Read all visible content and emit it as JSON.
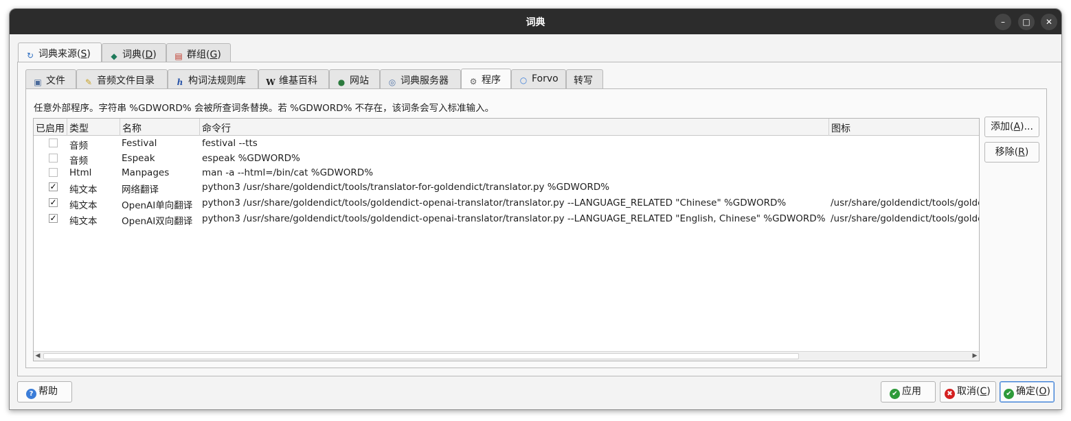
{
  "window": {
    "title": "词典",
    "controls": {
      "minimize": "–",
      "maximize": "□",
      "close": "✕"
    }
  },
  "main_tabs": [
    {
      "label": "词典来源(",
      "mnemonic": "S",
      "suffix": ")",
      "icon": "refresh-icon"
    },
    {
      "label": "词典(",
      "mnemonic": "D",
      "suffix": ")",
      "icon": "book-icon"
    },
    {
      "label": "群组(",
      "mnemonic": "G",
      "suffix": ")",
      "icon": "books-icon"
    }
  ],
  "source_tabs": [
    {
      "label": "文件",
      "icon": "file-icon"
    },
    {
      "label": "音频文件目录",
      "icon": "pencil-icon"
    },
    {
      "label": "构词法规则库",
      "icon": "italic-h-icon"
    },
    {
      "label": "维基百科",
      "icon": "wikipedia-icon"
    },
    {
      "label": "网站",
      "icon": "globe-icon"
    },
    {
      "label": "词典服务器",
      "icon": "server-icon"
    },
    {
      "label": "程序",
      "icon": "gear-icon"
    },
    {
      "label": "Forvo",
      "icon": "forvo-icon"
    },
    {
      "label": "转写",
      "icon": ""
    }
  ],
  "info_text": "任意外部程序。字符串 %GDWORD% 会被所查词条替换。若 %GDWORD% 不存在，该词条会写入标准输入。",
  "table": {
    "columns": [
      "已启用",
      "类型",
      "名称",
      "命令行",
      "图标"
    ],
    "rows": [
      {
        "enabled": false,
        "type": "音频",
        "name": "Festival",
        "command": "festival --tts",
        "icon": ""
      },
      {
        "enabled": false,
        "type": "音频",
        "name": "Espeak",
        "command": "espeak %GDWORD%",
        "icon": ""
      },
      {
        "enabled": false,
        "type": "Html",
        "name": "Manpages",
        "command": "man -a --html=/bin/cat %GDWORD%",
        "icon": ""
      },
      {
        "enabled": true,
        "type": "纯文本",
        "name": "网络翻译",
        "command": "python3 /usr/share/goldendict/tools/translator-for-goldendict/translator.py %GDWORD%",
        "icon": ""
      },
      {
        "enabled": true,
        "type": "纯文本",
        "name": "OpenAI单向翻译",
        "command": "python3 /usr/share/goldendict/tools/goldendict-openai-translator/translator.py --LANGUAGE_RELATED \"Chinese\" %GDWORD%",
        "icon": "/usr/share/goldendict/tools/goldendict-openai-translator/"
      },
      {
        "enabled": true,
        "type": "纯文本",
        "name": "OpenAI双向翻译",
        "command": "python3 /usr/share/goldendict/tools/goldendict-openai-translator/translator.py --LANGUAGE_RELATED \"English, Chinese\" %GDWORD%",
        "icon": "/usr/share/goldendict/tools/goldendict-openai-translator/"
      }
    ]
  },
  "side_buttons": {
    "add": {
      "label": "添加(",
      "mnemonic": "A",
      "suffix": ")..."
    },
    "remove": {
      "label": "移除(",
      "mnemonic": "R",
      "suffix": ")"
    }
  },
  "footer": {
    "help": {
      "label": "帮助",
      "icon_text": "?"
    },
    "apply": {
      "label": "应用",
      "icon_text": "✔"
    },
    "cancel": {
      "label": "取消(",
      "mnemonic": "C",
      "suffix": ")",
      "icon_text": "✖"
    },
    "ok": {
      "label": "确定(",
      "mnemonic": "O",
      "suffix": ")",
      "icon_text": "✔"
    }
  },
  "colors": {
    "titlebar": "#2c2c2c",
    "ok_green": "#2e9a3a",
    "cancel_red": "#d42020",
    "help_blue": "#3b7dd8",
    "default_border": "#3d7fd4"
  }
}
